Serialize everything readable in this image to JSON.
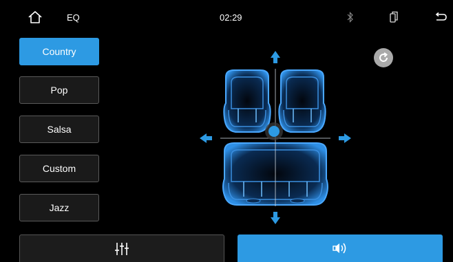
{
  "status_bar": {
    "title": "EQ",
    "time": "02:29",
    "icons": {
      "home": "home-icon",
      "bluetooth": "bluetooth-icon",
      "phone": "phone-icon",
      "back": "back-icon"
    }
  },
  "presets": [
    {
      "label": "Country",
      "active": true
    },
    {
      "label": "Pop",
      "active": false
    },
    {
      "label": "Salsa",
      "active": false
    },
    {
      "label": "Custom",
      "active": false
    },
    {
      "label": "Jazz",
      "active": false
    }
  ],
  "balance": {
    "reset_icon": "reset-icon",
    "arrows": [
      "arrow-up-icon",
      "arrow-down-icon",
      "arrow-left-icon",
      "arrow-right-icon"
    ]
  },
  "bottom_tabs": [
    {
      "icon": "equalizer-sliders-icon",
      "active": false
    },
    {
      "icon": "speaker-balance-icon",
      "active": true
    }
  ],
  "colors": {
    "accent": "#2d9ae3",
    "background": "#000000",
    "button": "#1a1a1a",
    "seat": "#1f6fc4"
  }
}
